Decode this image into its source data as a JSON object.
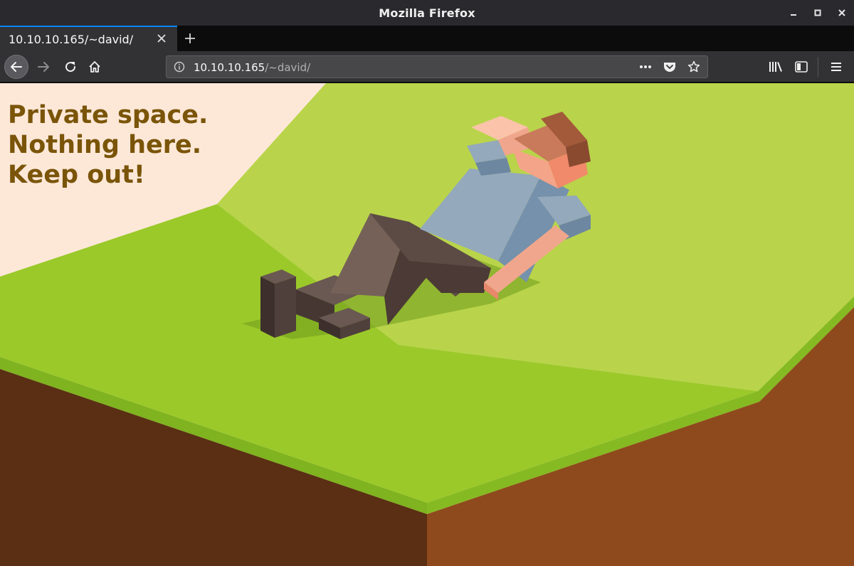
{
  "window": {
    "title": "Mozilla Firefox",
    "controls": [
      "minimize",
      "maximize",
      "close"
    ]
  },
  "tabs": [
    {
      "label": "10.10.10.165/~david/",
      "active": true
    }
  ],
  "navbar": {
    "url_host": "10.10.10.165",
    "url_path": "/~david/",
    "icons": [
      "back-icon",
      "forward-icon",
      "reload-icon",
      "home-icon",
      "info-icon",
      "page-actions-icon",
      "pocket-icon",
      "bookmark-star-icon",
      "library-icon",
      "sidebar-icon",
      "menu-icon"
    ]
  },
  "page": {
    "lines": [
      "Private space.",
      "Nothing here.",
      "Keep out!"
    ],
    "text_color": "#7a5509",
    "background_color": "#fde8d8",
    "grass_colors": [
      "#b9d44a",
      "#9bc92a",
      "#7fb31f"
    ],
    "soil_colors": [
      "#5a2f13",
      "#8e4a1c"
    ]
  }
}
